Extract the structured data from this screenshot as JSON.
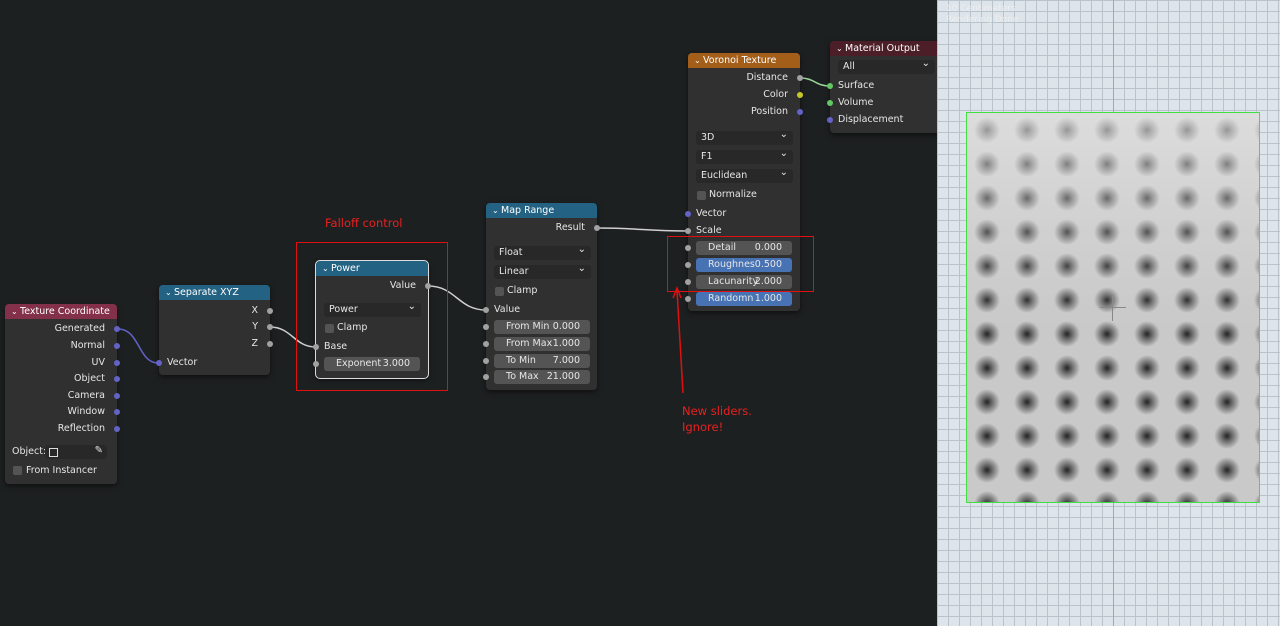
{
  "viewport_overlay": {
    "line1": "10 Centimeters",
    "line2": "Rendering Done"
  },
  "nodes": {
    "texcoord": {
      "title": "Texture Coordinate",
      "outputs": [
        "Generated",
        "Normal",
        "UV",
        "Object",
        "Camera",
        "Window",
        "Reflection"
      ],
      "object_label": "Object:",
      "from_instancer": "From Instancer"
    },
    "sepxyz": {
      "title": "Separate XYZ",
      "outputs": [
        "X",
        "Y",
        "Z"
      ],
      "input": "Vector"
    },
    "power": {
      "title": "Power",
      "output": "Value",
      "operation": "Power",
      "clamp": "Clamp",
      "base": "Base",
      "exponent_label": "Exponent",
      "exponent_value": "3.000"
    },
    "maprange": {
      "title": "Map Range",
      "output": "Result",
      "data_type": "Float",
      "interpolation": "Linear",
      "clamp": "Clamp",
      "value": "Value",
      "fields": [
        {
          "label": "From Min",
          "value": "0.000"
        },
        {
          "label": "From Max",
          "value": "1.000"
        },
        {
          "label": "To Min",
          "value": "7.000"
        },
        {
          "label": "To Max",
          "value": "21.000"
        }
      ]
    },
    "voronoi": {
      "title": "Voronoi Texture",
      "outputs": [
        "Distance",
        "Color",
        "Position"
      ],
      "dimensions": "3D",
      "feature": "F1",
      "metric": "Euclidean",
      "normalize": "Normalize",
      "inputs": [
        "Vector",
        "Scale"
      ],
      "fields": [
        {
          "label": "Detail",
          "value": "0.000"
        },
        {
          "label": "Roughnes",
          "value": "0.500"
        },
        {
          "label": "Lacunarity",
          "value": "2.000"
        },
        {
          "label": "Randomn",
          "value": "1.000"
        }
      ]
    },
    "matout": {
      "title": "Material Output",
      "target": "All",
      "inputs": [
        "Surface",
        "Volume",
        "Displacement"
      ]
    }
  },
  "annotations": {
    "falloff": "Falloff control",
    "sliders_line1": "New sliders.",
    "sliders_line2": "Ignore!"
  },
  "colors": {
    "header_input": "#83314a",
    "header_converter": "#246283",
    "header_texture": "#a35e1a",
    "header_output": "#4c1e27",
    "socket_vector": "#6363c7",
    "socket_float": "#a1a1a1",
    "socket_color": "#c7c729",
    "socket_shader": "#63c763",
    "annotation_red": "#e01010"
  },
  "icons": [
    "chevron-down-icon",
    "object-picker-icon",
    "eyedropper-icon",
    "checkbox-icon",
    "crosshair-icon"
  ]
}
